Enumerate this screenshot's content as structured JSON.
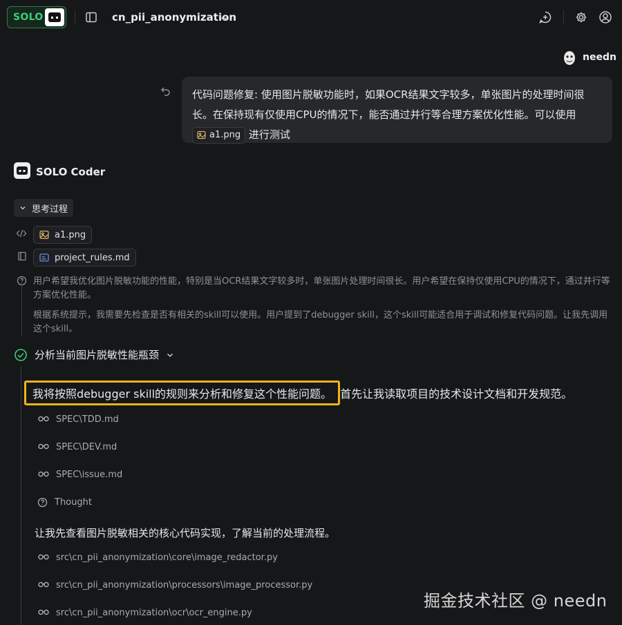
{
  "header": {
    "badge_label": "SOLO",
    "project_title": "cn_pii_anonymization"
  },
  "user": {
    "name": "needn",
    "message_part1": "代码问题修复: 使用图片脱敏功能时，如果OCR结果文字较多，单张图片的处理时间很长。在保持现有仅使用CPU的情况下，能否通过并行等合理方案优化性能。可以使用",
    "attachment": "a1.png",
    "message_part2": "进行测试"
  },
  "assistant": {
    "name": "SOLO Coder",
    "thinking_label": "思考过程",
    "context_files": [
      "a1.png",
      "project_rules.md"
    ],
    "thought_paragraphs": [
      "用户希望我优化图片脱敏功能的性能，特别是当OCR结果文字较多时，单张图片处理时间很长。用户希望在保持仅使用CPU的情况下，通过并行等方案优化性能。",
      "根据系统提示，我需要先检查是否有相关的skill可以使用。用户提到了debugger skill，这个skill可能适合用于调试和修复代码问题。让我先调用这个skill。"
    ],
    "step_title": "分析当前图片脱敏性能瓶颈",
    "highlighted_text": "我将按照debugger skill的规则来分析和修复这个性能问题。",
    "followup_text": "首先让我读取项目的技术设计文档和开发规范。",
    "read_files_1": [
      "SPEC\\TDD.md",
      "SPEC\\DEV.md",
      "SPEC\\issue.md"
    ],
    "thought_label": "Thought",
    "second_text": "让我先查看图片脱敏相关的核心代码实现，了解当前的处理流程。",
    "read_files_2": [
      "src\\cn_pii_anonymization\\core\\image_redactor.py",
      "src\\cn_pii_anonymization\\processors\\image_processor.py",
      "src\\cn_pii_anonymization\\ocr\\ocr_engine.py"
    ]
  },
  "watermark": "掘金技术社区 @ needn",
  "colors": {
    "background": "#161719",
    "accent_green": "#3ad07a",
    "highlight": "#f0b41c",
    "bubble": "#26282b"
  }
}
